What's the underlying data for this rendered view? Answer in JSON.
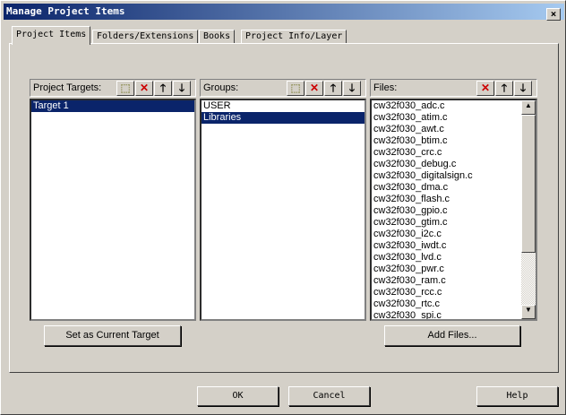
{
  "window": {
    "title": "Manage Project Items",
    "close": "×"
  },
  "tabs": [
    "Project Items",
    "Folders/Extensions",
    "Books",
    "Project Info/Layer"
  ],
  "targets": {
    "label": "Project Targets:",
    "items": [
      "Target 1"
    ],
    "set_current": "Set as Current Target"
  },
  "groups": {
    "label": "Groups:",
    "items": [
      "USER",
      "Libraries"
    ]
  },
  "files": {
    "label": "Files:",
    "items": [
      "cw32f030_adc.c",
      "cw32f030_atim.c",
      "cw32f030_awt.c",
      "cw32f030_btim.c",
      "cw32f030_crc.c",
      "cw32f030_debug.c",
      "cw32f030_digitalsign.c",
      "cw32f030_dma.c",
      "cw32f030_flash.c",
      "cw32f030_gpio.c",
      "cw32f030_gtim.c",
      "cw32f030_i2c.c",
      "cw32f030_iwdt.c",
      "cw32f030_lvd.c",
      "cw32f030_pwr.c",
      "cw32f030_ram.c",
      "cw32f030_rcc.c",
      "cw32f030_rtc.c",
      "cw32f030_spi.c"
    ],
    "add": "Add Files..."
  },
  "buttons": {
    "ok": "OK",
    "cancel": "Cancel",
    "help": "Help"
  },
  "icons": {
    "new": "⬚",
    "delete": "✕",
    "up": "🡑",
    "down": "🡓"
  }
}
